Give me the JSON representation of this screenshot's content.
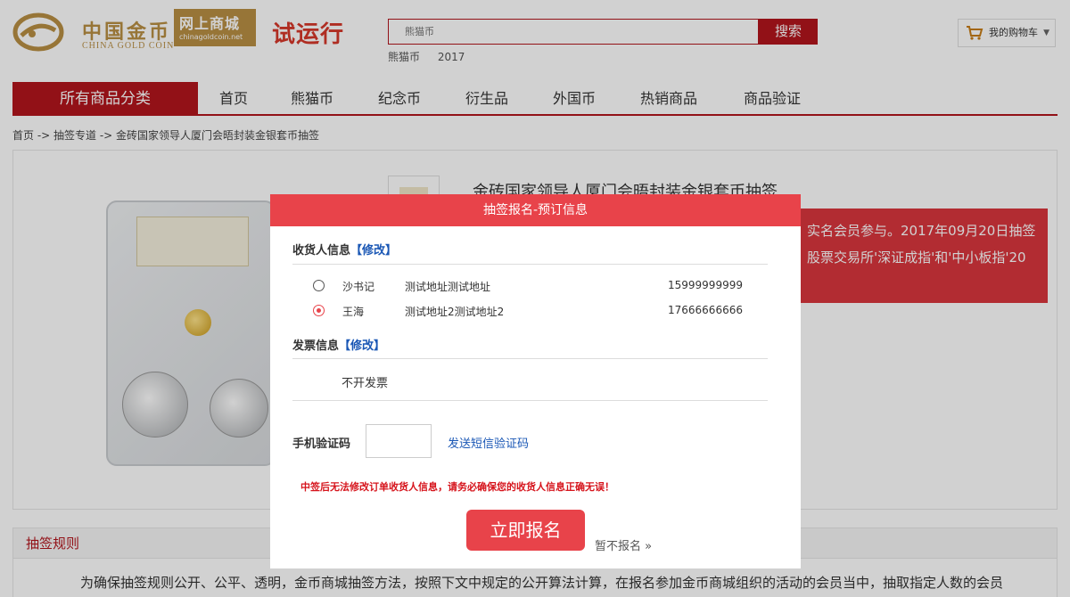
{
  "header": {
    "logo_cn": "中国金币",
    "logo_en": "CHINA GOLD COIN",
    "shop_name": "网上商城",
    "shop_url": "chinagoldcoin.net",
    "trial_label": "试运行",
    "search_placeholder": "熊猫币",
    "search_button": "搜索",
    "hot_words": [
      "熊猫币",
      "2017"
    ],
    "cart_label": "我的购物车"
  },
  "nav": {
    "all_label": "所有商品分类",
    "items": [
      "首页",
      "熊猫币",
      "纪念币",
      "衍生品",
      "外国币",
      "热销商品",
      "商品验证"
    ]
  },
  "breadcrumb": "首页 -> 抽签专道 -> 金砖国家领导人厦门会晤封装金银套币抽签",
  "product": {
    "title": "金砖国家领导人厦门会晤封装金银套币抽签",
    "info_line1": "实名会员参与。2017年09月20日抽签",
    "info_line2": "股票交易所'深证成指'和'中小板指'20"
  },
  "rules": {
    "title": "抽签规则",
    "text": "为确保抽签规则公开、公平、透明，金币商城抽签方法，按照下文中规定的公开算法计算，在报名参加金币商城组织的活动的会员当中，抽取指定人数的会员"
  },
  "modal": {
    "title": "抽签报名-预订信息",
    "consignee_title": "收货人信息",
    "edit_label": "【修改】",
    "addresses": [
      {
        "name": "沙书记",
        "address": "测试地址测试地址",
        "phone": "15999999999",
        "selected": false
      },
      {
        "name": "王海",
        "address": "测试地址2测试地址2",
        "phone": "17666666666",
        "selected": true
      }
    ],
    "invoice_title": "发票信息",
    "invoice_value": "不开发票",
    "code_label": "手机验证码",
    "send_code": "发送短信验证码",
    "warning": "中签后无法修改订单收货人信息，请务必确保您的收货人信息正确无误！",
    "submit": "立即报名",
    "skip": "暂不报名 »"
  },
  "colors": {
    "brand_red": "#b3151d",
    "modal_red": "#e8434a",
    "gold": "#b98f44",
    "link_blue": "#1a57b5"
  }
}
